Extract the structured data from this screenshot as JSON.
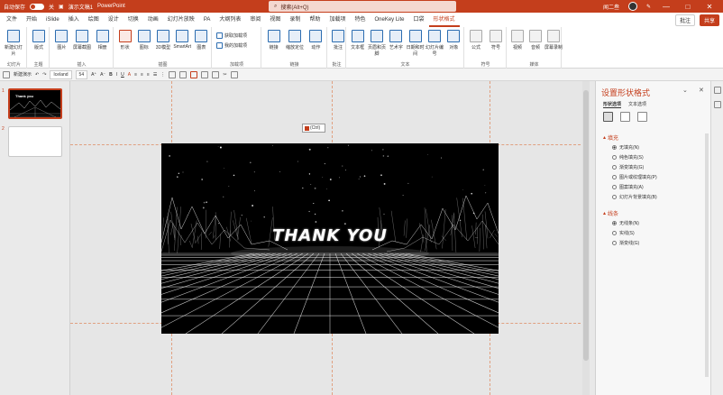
{
  "titlebar": {
    "autosave_label": "自动保存",
    "toggle_state": "关",
    "doc_name": "演示文稿1",
    "app_name": "PowerPoint",
    "search_placeholder": "搜索(Alt+Q)",
    "user": "闻二叁",
    "win_min": "—",
    "win_max": "□",
    "win_close": "✕"
  },
  "menu": {
    "tabs": [
      "文件",
      "开始",
      "iSlide",
      "插入",
      "绘图",
      "设计",
      "切换",
      "动画",
      "幻灯片放映",
      "PA",
      "大纲列表",
      "审阅",
      "视图",
      "录制",
      "帮助",
      "加载项",
      "特色",
      "OneKey Lite",
      "口袋",
      "形状格式"
    ],
    "active_index": 19,
    "comment_label": "批注",
    "share_label": "共享"
  },
  "ribbon": {
    "groups": [
      {
        "label": "幻灯片",
        "buttons": [
          "新建幻灯片"
        ]
      },
      {
        "label": "主题",
        "buttons": [
          "版式"
        ]
      },
      {
        "label": "插入",
        "buttons": [
          "图片",
          "屏幕截图",
          "相册"
        ]
      },
      {
        "label": "插图",
        "buttons": [
          "形状",
          "图标",
          "3D模型",
          "SmartArt",
          "图表"
        ]
      },
      {
        "label": "加载项",
        "buttons": [
          "获取加载项",
          "我的加载项"
        ]
      },
      {
        "label": "链接",
        "buttons": [
          "链接",
          "缩放定位",
          "动作"
        ]
      },
      {
        "label": "批注",
        "buttons": [
          "批注"
        ]
      },
      {
        "label": "文本",
        "buttons": [
          "文本框",
          "页眉和页脚",
          "艺术字",
          "日期和时间",
          "幻灯片编号",
          "对象"
        ]
      },
      {
        "label": "符号",
        "buttons": [
          "公式",
          "符号"
        ]
      },
      {
        "label": "媒体",
        "buttons": [
          "视频",
          "音频",
          "屏幕录制"
        ]
      }
    ]
  },
  "format_toolbar": {
    "items": [
      "新建演示",
      "撤销",
      "恢复",
      "字体",
      "字号",
      "加粗",
      "倾斜",
      "下划线",
      "字体颜色",
      "对齐",
      "排列",
      "形状填充"
    ],
    "font_name": "Iceland",
    "font_size": "54"
  },
  "thumbs": {
    "slides": [
      {
        "num": "1",
        "title": "Thank you"
      },
      {
        "num": "2",
        "title": ""
      }
    ]
  },
  "slide": {
    "title": "THANK YOU",
    "ctrl_tag": "(Ctrl)"
  },
  "pane": {
    "title": "设置形状格式",
    "close": "✕",
    "options": "⌄",
    "tabs": [
      "形状选项",
      "文本选项"
    ],
    "fill_section": {
      "title": "填充",
      "options": [
        "无填充(N)",
        "纯色填充(S)",
        "渐变填充(G)",
        "图片或纹理填充(P)",
        "图案填充(A)",
        "幻灯片背景填充(B)"
      ],
      "selected": 0
    },
    "line_section": {
      "title": "线条",
      "options": [
        "无线条(N)",
        "实线(S)",
        "渐变线(G)"
      ],
      "selected": 0
    }
  },
  "colors": {
    "accent": "#c43e1c",
    "slide_bg": "#000000",
    "grid": "#ffffff"
  }
}
